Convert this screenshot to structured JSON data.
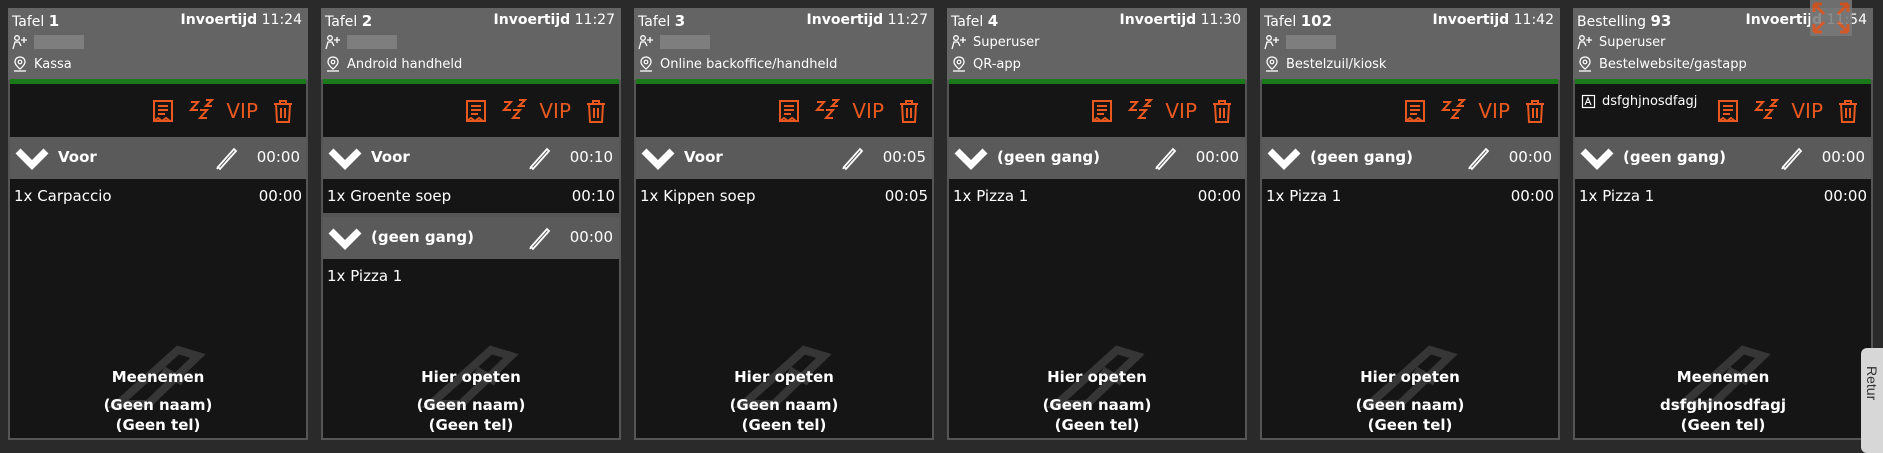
{
  "colors": {
    "accent": "#e8581f",
    "green": "#1a7a1a",
    "card_bg": "#555555",
    "dark": "#151515"
  },
  "icons": {
    "user": "waiter-icon",
    "location": "location-pin-icon",
    "receipt": "receipt-icon",
    "snooze": "snooze-icon",
    "vip": "vip-label",
    "trash": "trash-icon",
    "chevron": "chevron-down-icon",
    "pen": "pen-icon",
    "note": "note-icon",
    "watermark": "knife-icon",
    "expand": "expand-icon"
  },
  "cards": [
    {
      "title_prefix": "Tafel",
      "number": "1",
      "time_label": "Invoertijd",
      "time": "11:24",
      "user": "",
      "location": "Kassa",
      "note": "",
      "vip": "VIP",
      "courses": [
        {
          "name": "Voor",
          "time": "00:00",
          "items": [
            {
              "text": "1x Carpaccio",
              "time": "00:00"
            }
          ]
        }
      ],
      "footer": [
        "Meenemen",
        "(Geen naam)",
        "(Geen tel)"
      ]
    },
    {
      "title_prefix": "Tafel",
      "number": "2",
      "time_label": "Invoertijd",
      "time": "11:27",
      "user": "",
      "location": "Android handheld",
      "note": "",
      "vip": "VIP",
      "courses": [
        {
          "name": "Voor",
          "time": "00:10",
          "items": [
            {
              "text": "1x Groente soep",
              "time": "00:10"
            }
          ]
        },
        {
          "name": "(geen gang)",
          "time": "00:00",
          "items": [
            {
              "text": "1x Pizza 1",
              "time": ""
            }
          ]
        }
      ],
      "footer": [
        "Hier opeten",
        "(Geen naam)",
        "(Geen tel)"
      ]
    },
    {
      "title_prefix": "Tafel",
      "number": "3",
      "time_label": "Invoertijd",
      "time": "11:27",
      "user": "",
      "location": "Online backoffice/handheld",
      "note": "",
      "vip": "VIP",
      "courses": [
        {
          "name": "Voor",
          "time": "00:05",
          "items": [
            {
              "text": "1x Kippen soep",
              "time": "00:05"
            }
          ]
        }
      ],
      "footer": [
        "Hier opeten",
        "(Geen naam)",
        "(Geen tel)"
      ]
    },
    {
      "title_prefix": "Tafel",
      "number": "4",
      "time_label": "Invoertijd",
      "time": "11:30",
      "user": "Superuser",
      "location": "QR-app",
      "note": "",
      "vip": "VIP",
      "courses": [
        {
          "name": "(geen gang)",
          "time": "00:00",
          "items": [
            {
              "text": "1x Pizza 1",
              "time": "00:00"
            }
          ]
        }
      ],
      "footer": [
        "Hier opeten",
        "(Geen naam)",
        "(Geen tel)"
      ]
    },
    {
      "title_prefix": "Tafel",
      "number": "102",
      "time_label": "Invoertijd",
      "time": "11:42",
      "user": "",
      "location": "Bestelzuil/kiosk",
      "note": "",
      "vip": "VIP",
      "courses": [
        {
          "name": "(geen gang)",
          "time": "00:00",
          "items": [
            {
              "text": "1x Pizza 1",
              "time": "00:00"
            }
          ]
        }
      ],
      "footer": [
        "Hier opeten",
        "(Geen naam)",
        "(Geen tel)"
      ]
    },
    {
      "title_prefix": "Bestelling",
      "number": "93",
      "time_label": "Invoertijd",
      "time": "11:54",
      "user": "Superuser",
      "location": "Bestelwebsite/gastapp",
      "note": "dsfghjnosdfagj",
      "vip": "VIP",
      "courses": [
        {
          "name": "(geen gang)",
          "time": "00:00",
          "items": [
            {
              "text": "1x Pizza 1",
              "time": "00:00"
            }
          ]
        }
      ],
      "footer": [
        "Meenemen",
        "dsfghjnosdfagj",
        "(Geen tel)"
      ]
    }
  ],
  "side_tab": "Retur"
}
